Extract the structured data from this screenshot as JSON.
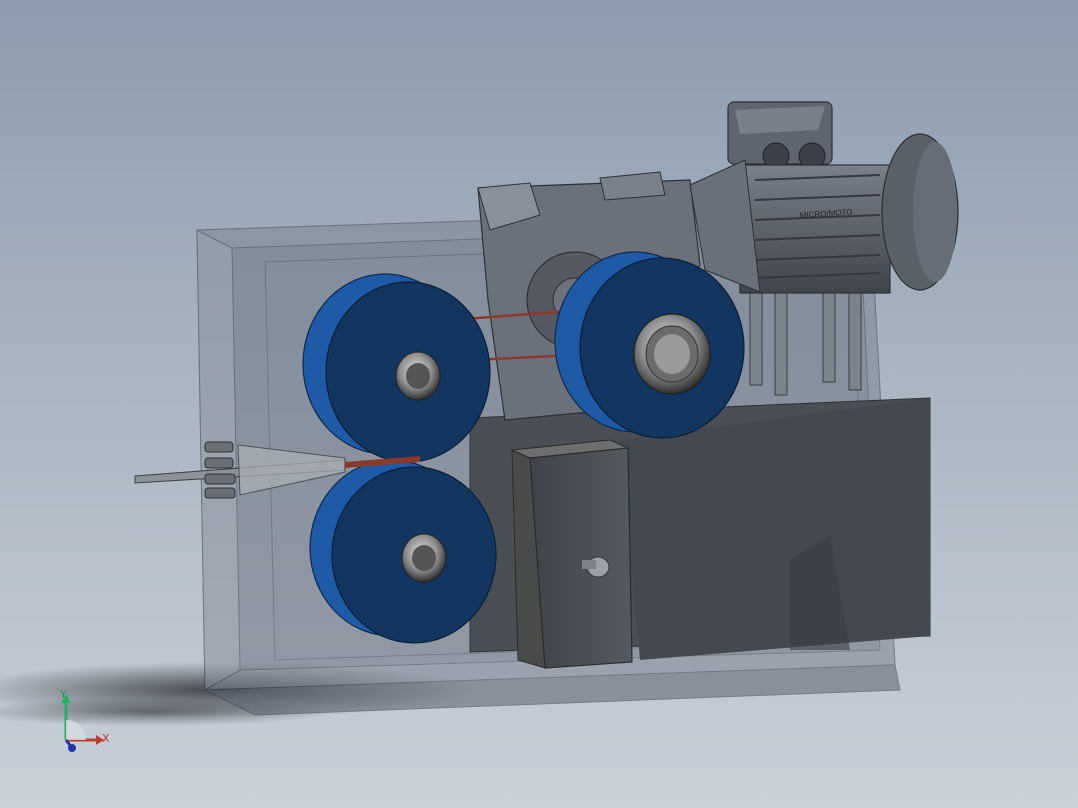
{
  "viewport": {
    "background_top": "#8c9cae",
    "background_bottom": "#c9d0d8"
  },
  "model": {
    "housing_color": "#6e7684",
    "roller_color": "#1f5aa6",
    "roller_face_color": "#12365f",
    "motor_color": "#5b616b",
    "block_color": "#4b4f55",
    "motor_label": "MICRO/MOTO"
  },
  "triad": {
    "x_label": "X",
    "y_label": "Y",
    "x_color": "#c0392b",
    "y_color": "#27ae60",
    "z_color": "#2134a8"
  },
  "icons": [
    "axis-triad-icon"
  ]
}
